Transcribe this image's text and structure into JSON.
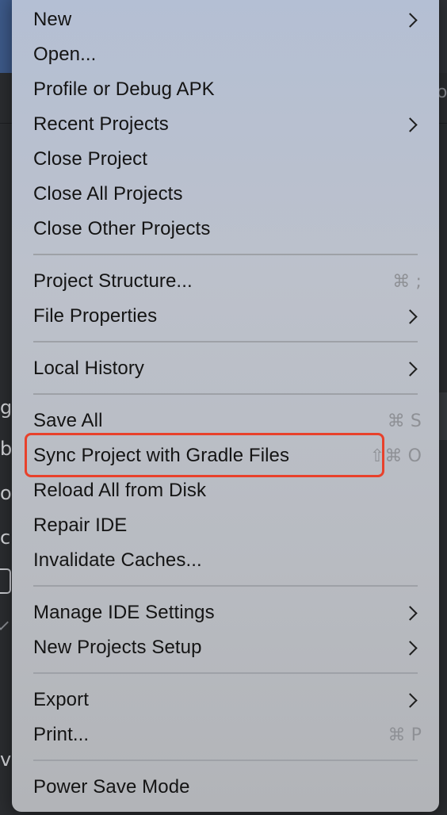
{
  "background": {
    "left_fragments": [
      "g",
      "b",
      "o",
      "c",
      "vi"
    ],
    "right_fragment": "o"
  },
  "menu": {
    "items": [
      {
        "label": "New",
        "shortcut": "",
        "submenu": true
      },
      {
        "label": "Open...",
        "shortcut": "",
        "submenu": false
      },
      {
        "label": "Profile or Debug APK",
        "shortcut": "",
        "submenu": false
      },
      {
        "label": "Recent Projects",
        "shortcut": "",
        "submenu": true
      },
      {
        "label": "Close Project",
        "shortcut": "",
        "submenu": false
      },
      {
        "label": "Close All Projects",
        "shortcut": "",
        "submenu": false
      },
      {
        "label": "Close Other Projects",
        "shortcut": "",
        "submenu": false
      },
      {
        "label": "Project Structure...",
        "shortcut": "⌘ ;",
        "submenu": false
      },
      {
        "label": "File Properties",
        "shortcut": "",
        "submenu": true
      },
      {
        "label": "Local History",
        "shortcut": "",
        "submenu": true
      },
      {
        "label": "Save All",
        "shortcut": "⌘ S",
        "submenu": false
      },
      {
        "label": "Sync Project with Gradle Files",
        "shortcut": "⇧⌘ O",
        "submenu": false
      },
      {
        "label": "Reload All from Disk",
        "shortcut": "",
        "submenu": false
      },
      {
        "label": "Repair IDE",
        "shortcut": "",
        "submenu": false
      },
      {
        "label": "Invalidate Caches...",
        "shortcut": "",
        "submenu": false
      },
      {
        "label": "Manage IDE Settings",
        "shortcut": "",
        "submenu": true
      },
      {
        "label": "New Projects Setup",
        "shortcut": "",
        "submenu": true
      },
      {
        "label": "Export",
        "shortcut": "",
        "submenu": true
      },
      {
        "label": "Print...",
        "shortcut": "⌘ P",
        "submenu": false
      },
      {
        "label": "Power Save Mode",
        "shortcut": "",
        "submenu": false
      }
    ],
    "highlighted_item": "Sync Project with Gradle Files",
    "highlight_color": "#e8412b"
  }
}
